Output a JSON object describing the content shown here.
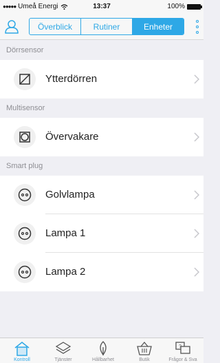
{
  "status": {
    "carrier": "Umeå Energi",
    "time": "13:37",
    "battery": "100%"
  },
  "nav": {
    "segments": [
      "Överblick",
      "Rutiner",
      "Enheter"
    ],
    "active_segment": "Enheter"
  },
  "sections": [
    {
      "header": "Dörrsensor",
      "items": [
        {
          "label": "Ytterdörren",
          "icon": "door-sensor-icon"
        }
      ]
    },
    {
      "header": "Multisensor",
      "items": [
        {
          "label": "Övervakare",
          "icon": "multisensor-icon"
        }
      ]
    },
    {
      "header": "Smart plug",
      "items": [
        {
          "label": "Golvlampa",
          "icon": "smart-plug-icon"
        },
        {
          "label": "Lampa 1",
          "icon": "smart-plug-icon"
        },
        {
          "label": "Lampa 2",
          "icon": "smart-plug-icon"
        }
      ]
    }
  ],
  "tabbar": {
    "tabs": [
      {
        "label": "Kontroll",
        "icon": "home-icon",
        "active": true
      },
      {
        "label": "Tjänster",
        "icon": "layers-icon",
        "active": false
      },
      {
        "label": "Hållbarhet",
        "icon": "leaf-icon",
        "active": false
      },
      {
        "label": "Butik",
        "icon": "basket-icon",
        "active": false
      },
      {
        "label": "Frågor & Sva",
        "icon": "chat-icon",
        "active": false
      }
    ]
  },
  "colors": {
    "accent": "#2ea8e6",
    "background": "#efeff4"
  }
}
